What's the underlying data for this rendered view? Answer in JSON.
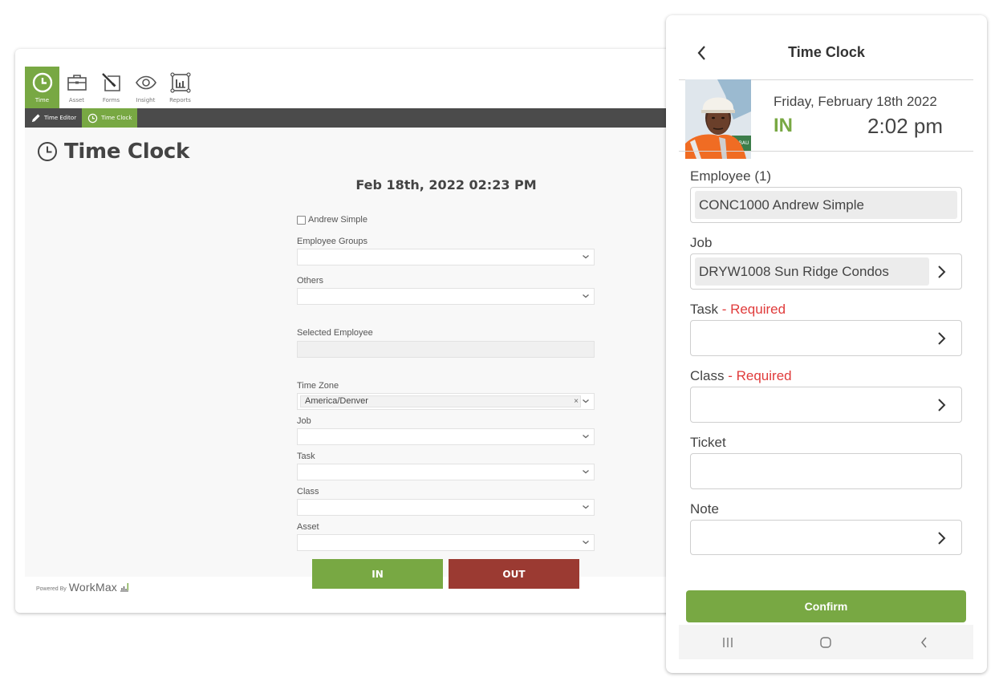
{
  "web": {
    "modules": [
      {
        "label": "Time",
        "icon": "clock-icon",
        "active": true
      },
      {
        "label": "Asset",
        "icon": "briefcase-icon",
        "active": false
      },
      {
        "label": "Forms",
        "icon": "forms-pen-icon",
        "active": false
      },
      {
        "label": "Insight",
        "icon": "eye-icon",
        "active": false
      },
      {
        "label": "Reports",
        "icon": "bar-chart-icon",
        "active": false
      }
    ],
    "subtabs": [
      {
        "label": "Time Editor",
        "icon": "pencil-icon",
        "active": false
      },
      {
        "label": "Time Clock",
        "icon": "clock-icon",
        "active": true
      }
    ],
    "page_title": "Time Clock",
    "datetime": "Feb 18th, 2022 02:23 PM",
    "form": {
      "employee_checkbox_label": "Andrew Simple",
      "employee_checkbox_checked": false,
      "employee_groups_label": "Employee Groups",
      "employee_groups_value": "",
      "others_label": "Others",
      "others_value": "",
      "selected_employee_label": "Selected Employee",
      "selected_employee_value": "",
      "time_zone_label": "Time Zone",
      "time_zone_value": "America/Denver",
      "time_zone_clear": "×",
      "job_label": "Job",
      "job_value": "",
      "task_label": "Task",
      "task_value": "",
      "class_label": "Class",
      "class_value": "",
      "asset_label": "Asset",
      "asset_value": ""
    },
    "buttons": {
      "in_label": "IN",
      "out_label": "OUT"
    },
    "colors": {
      "accent_green": "#78a843",
      "out_red": "#9b3a32",
      "subnav_dark": "#4b4b4b"
    },
    "footer": {
      "powered_by": "Powered By",
      "brand": "WorkMax"
    }
  },
  "mobile": {
    "title": "Time Clock",
    "date": "Friday, February 18th 2022",
    "status": "IN",
    "time": "2:02 pm",
    "fields": {
      "employee_label": "Employee (1)",
      "employee_value": "CONC1000    Andrew Simple",
      "job_label": "Job",
      "job_value": "DRYW1008 Sun Ridge Condos",
      "task_label": "Task",
      "task_required": " - Required",
      "task_value": "",
      "class_label": "Class",
      "class_required": " - Required",
      "class_value": "",
      "ticket_label": "Ticket",
      "ticket_value": "",
      "note_label": "Note",
      "note_value": ""
    },
    "confirm_label": "Confirm",
    "colors": {
      "status_green": "#78a843",
      "required_red": "#e03b3b"
    }
  }
}
